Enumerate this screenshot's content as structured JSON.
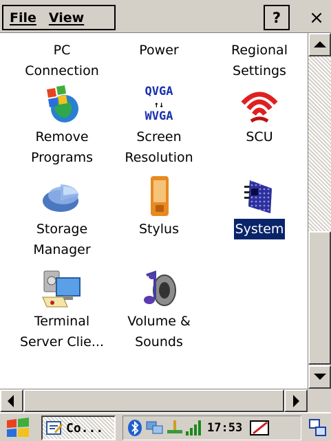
{
  "menu": {
    "file": "File",
    "view": "View",
    "help": "?",
    "close": "×"
  },
  "items": [
    {
      "label_1": "PC",
      "label_2": "Connection",
      "icon": "pc-connection-icon"
    },
    {
      "label_1": "Power",
      "label_2": "",
      "icon": "power-icon"
    },
    {
      "label_1": "Regional",
      "label_2": "Settings",
      "icon": "regional-settings-icon"
    },
    {
      "label_1": "Remove",
      "label_2": "Programs",
      "icon": "remove-programs-icon"
    },
    {
      "label_1": "Screen",
      "label_2": "Resolution",
      "icon": "screen-resolution-icon",
      "icon_text_1": "QVGA",
      "icon_text_2": "WVGA",
      "icon_arrows": "↑↓"
    },
    {
      "label_1": "SCU",
      "label_2": "",
      "icon": "scu-icon"
    },
    {
      "label_1": "Storage",
      "label_2": "Manager",
      "icon": "storage-manager-icon"
    },
    {
      "label_1": "Stylus",
      "label_2": "",
      "icon": "stylus-icon"
    },
    {
      "label_1": "System",
      "label_2": "",
      "icon": "system-icon",
      "selected": true
    },
    {
      "label_1": "Terminal",
      "label_2": "Server Clie...",
      "icon": "terminal-server-icon"
    },
    {
      "label_1": "Volume &",
      "label_2": "Sounds",
      "icon": "volume-sounds-icon"
    }
  ],
  "taskbar": {
    "task_label": "Co...",
    "clock": "17:53"
  },
  "colors": {
    "selection": "#0a246a",
    "chrome": "#d4d0c8"
  }
}
